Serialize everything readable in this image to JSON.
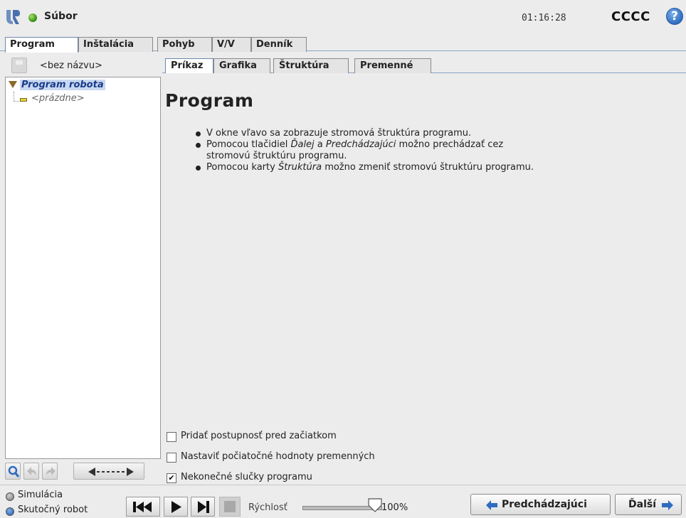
{
  "header": {
    "file_label": "Súbor",
    "clock": "01:16:28",
    "robot_name": "CCCC",
    "help_symbol": "?"
  },
  "main_tabs": [
    {
      "label": "Program",
      "active": true
    },
    {
      "label": "Inštalácia",
      "active": false
    },
    {
      "label": "Pohyb",
      "active": false
    },
    {
      "label": "V/V",
      "active": false
    },
    {
      "label": "Denník",
      "active": false
    }
  ],
  "left": {
    "program_name": "<bez názvu>",
    "tree_root": "Program robota",
    "tree_empty": "<prázdne>"
  },
  "sub_tabs": [
    {
      "label": "Príkaz",
      "active": true
    },
    {
      "label": "Grafika",
      "active": false
    },
    {
      "label": "Štruktúra",
      "active": false
    },
    {
      "label": "Premenné",
      "active": false
    }
  ],
  "content": {
    "title": "Program",
    "bullets": [
      {
        "parts": [
          {
            "t": "V okne vľavo sa zobrazuje stromová štruktúra programu.",
            "i": false
          }
        ]
      },
      {
        "parts": [
          {
            "t": "Pomocou tlačidiel ",
            "i": false
          },
          {
            "t": "Ďalej",
            "i": true
          },
          {
            "t": " a ",
            "i": false
          },
          {
            "t": "Predchádzajúci",
            "i": true
          },
          {
            "t": " možno prechádzať cez",
            "i": false
          },
          {
            "t": "\nstromovú štruktúru programu.",
            "i": false
          }
        ]
      },
      {
        "parts": [
          {
            "t": "Pomocou karty ",
            "i": false
          },
          {
            "t": "Štruktúra",
            "i": true
          },
          {
            "t": " možno zmeniť stromovú štruktúru programu.",
            "i": false
          }
        ]
      }
    ],
    "checkboxes": [
      {
        "label": "Pridať postupnosť pred začiatkom",
        "checked": false
      },
      {
        "label": "Nastaviť počiatočné hodnoty premenných",
        "checked": false
      },
      {
        "label": "Nekonečné slučky programu",
        "checked": true
      }
    ]
  },
  "footer": {
    "simulation_label": "Simulácia",
    "real_robot_label": "Skutočný robot",
    "mode_selected": "Skutočný robot",
    "speed_label": "Rýchlosť",
    "speed_value": "100%",
    "speed_fraction": 1.0,
    "prev_label": "Predchádzajúci",
    "next_label": "Ďalší"
  },
  "colors": {
    "accent": "#2e6cc0",
    "tree_root_text": "#1a3a8a",
    "tree_root_bg": "#c8d8f0",
    "status_green": "#2f8a10"
  },
  "icons": {
    "logo": "ur-logo-icon",
    "status": "robot-status-icon",
    "help": "help-icon",
    "save": "save-icon",
    "search": "search-icon",
    "undo": "undo-icon",
    "redo": "redo-icon",
    "move": "move-arrows-icon",
    "rewind": "rewind-icon",
    "play": "play-icon",
    "step": "step-icon",
    "stop": "stop-icon",
    "prev_arrow": "arrow-left-icon",
    "next_arrow": "arrow-right-icon"
  }
}
